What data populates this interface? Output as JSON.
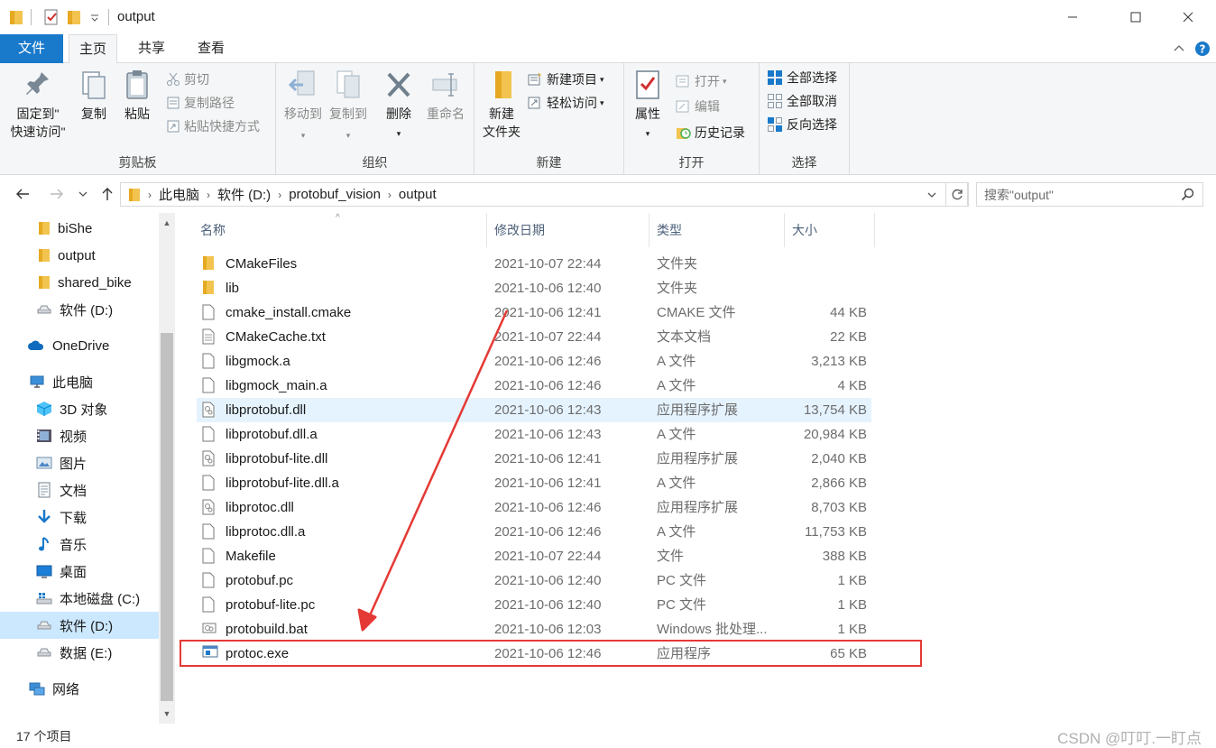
{
  "window": {
    "title": "output"
  },
  "tabs": [
    {
      "label": "文件"
    },
    {
      "label": "主页"
    },
    {
      "label": "共享"
    },
    {
      "label": "查看"
    }
  ],
  "ribbon": {
    "clipboard": {
      "pin": "固定到\"快速访问\"",
      "pin_line1": "固定到\"",
      "pin_line2": "快速访问\"",
      "copy": "复制",
      "paste": "粘贴",
      "cut": "剪切",
      "copy_path": "复制路径",
      "paste_shortcut": "粘贴快捷方式",
      "label": "剪贴板"
    },
    "organize": {
      "move_to": "移动到",
      "copy_to": "复制到",
      "delete": "删除",
      "rename": "重命名",
      "label": "组织"
    },
    "new": {
      "new_folder_line1": "新建",
      "new_folder_line2": "文件夹",
      "new_item": "新建项目",
      "easy_access": "轻松访问",
      "label": "新建"
    },
    "open": {
      "properties": "属性",
      "open": "打开",
      "edit": "编辑",
      "history": "历史记录",
      "label": "打开"
    },
    "select": {
      "select_all": "全部选择",
      "select_none": "全部取消",
      "invert": "反向选择",
      "label": "选择"
    }
  },
  "address": {
    "breadcrumbs": [
      "此电脑",
      "软件 (D:)",
      "protobuf_vision",
      "output"
    ],
    "search_placeholder": "搜索\"output\""
  },
  "sidebar": [
    {
      "label": "biShe",
      "icon": "folder-icon"
    },
    {
      "label": "output",
      "icon": "folder-icon"
    },
    {
      "label": "shared_bike",
      "icon": "folder-icon"
    },
    {
      "label": "软件 (D:)",
      "icon": "drive-icon"
    },
    {
      "label": "OneDrive",
      "icon": "cloud-icon"
    },
    {
      "label": "此电脑",
      "icon": "computer-icon"
    },
    {
      "label": "3D 对象",
      "icon": "cube-icon"
    },
    {
      "label": "视频",
      "icon": "video-icon"
    },
    {
      "label": "图片",
      "icon": "picture-icon"
    },
    {
      "label": "文档",
      "icon": "document-icon"
    },
    {
      "label": "下载",
      "icon": "download-icon"
    },
    {
      "label": "音乐",
      "icon": "music-icon"
    },
    {
      "label": "桌面",
      "icon": "desktop-icon"
    },
    {
      "label": "本地磁盘 (C:)",
      "icon": "system-drive-icon"
    },
    {
      "label": "软件 (D:)",
      "icon": "drive-icon"
    },
    {
      "label": "数据 (E:)",
      "icon": "drive-icon"
    },
    {
      "label": "网络",
      "icon": "network-icon"
    }
  ],
  "columns": {
    "name": "名称",
    "date": "修改日期",
    "type": "类型",
    "size": "大小"
  },
  "files": [
    {
      "name": "CMakeFiles",
      "date": "2021-10-07 22:44",
      "type": "文件夹",
      "size": "",
      "icon": "folder-icon"
    },
    {
      "name": "lib",
      "date": "2021-10-06 12:40",
      "type": "文件夹",
      "size": "",
      "icon": "folder-icon"
    },
    {
      "name": "cmake_install.cmake",
      "date": "2021-10-06 12:41",
      "type": "CMAKE 文件",
      "size": "44 KB",
      "icon": "file-icon"
    },
    {
      "name": "CMakeCache.txt",
      "date": "2021-10-07 22:44",
      "type": "文本文档",
      "size": "22 KB",
      "icon": "text-file-icon"
    },
    {
      "name": "libgmock.a",
      "date": "2021-10-06 12:46",
      "type": "A 文件",
      "size": "3,213 KB",
      "icon": "file-icon"
    },
    {
      "name": "libgmock_main.a",
      "date": "2021-10-06 12:46",
      "type": "A 文件",
      "size": "4 KB",
      "icon": "file-icon"
    },
    {
      "name": "libprotobuf.dll",
      "date": "2021-10-06 12:43",
      "type": "应用程序扩展",
      "size": "13,754 KB",
      "icon": "dll-icon"
    },
    {
      "name": "libprotobuf.dll.a",
      "date": "2021-10-06 12:43",
      "type": "A 文件",
      "size": "20,984 KB",
      "icon": "file-icon"
    },
    {
      "name": "libprotobuf-lite.dll",
      "date": "2021-10-06 12:41",
      "type": "应用程序扩展",
      "size": "2,040 KB",
      "icon": "dll-icon"
    },
    {
      "name": "libprotobuf-lite.dll.a",
      "date": "2021-10-06 12:41",
      "type": "A 文件",
      "size": "2,866 KB",
      "icon": "file-icon"
    },
    {
      "name": "libprotoc.dll",
      "date": "2021-10-06 12:46",
      "type": "应用程序扩展",
      "size": "8,703 KB",
      "icon": "dll-icon"
    },
    {
      "name": "libprotoc.dll.a",
      "date": "2021-10-06 12:46",
      "type": "A 文件",
      "size": "11,753 KB",
      "icon": "file-icon"
    },
    {
      "name": "Makefile",
      "date": "2021-10-07 22:44",
      "type": "文件",
      "size": "388 KB",
      "icon": "file-icon"
    },
    {
      "name": "protobuf.pc",
      "date": "2021-10-06 12:40",
      "type": "PC 文件",
      "size": "1 KB",
      "icon": "file-icon"
    },
    {
      "name": "protobuf-lite.pc",
      "date": "2021-10-06 12:40",
      "type": "PC 文件",
      "size": "1 KB",
      "icon": "file-icon"
    },
    {
      "name": "protobuild.bat",
      "date": "2021-10-06 12:03",
      "type": "Windows 批处理...",
      "size": "1 KB",
      "icon": "batch-icon"
    },
    {
      "name": "protoc.exe",
      "date": "2021-10-06 12:46",
      "type": "应用程序",
      "size": "65 KB",
      "icon": "exe-icon"
    }
  ],
  "status": {
    "item_count": "17 个项目",
    "watermark": "CSDN @叮叮.一盯点"
  },
  "colors": {
    "accent": "#1979ca",
    "selection": "#cce8ff",
    "hover_row": "#e5f3ff",
    "annotation": "#e53935"
  }
}
